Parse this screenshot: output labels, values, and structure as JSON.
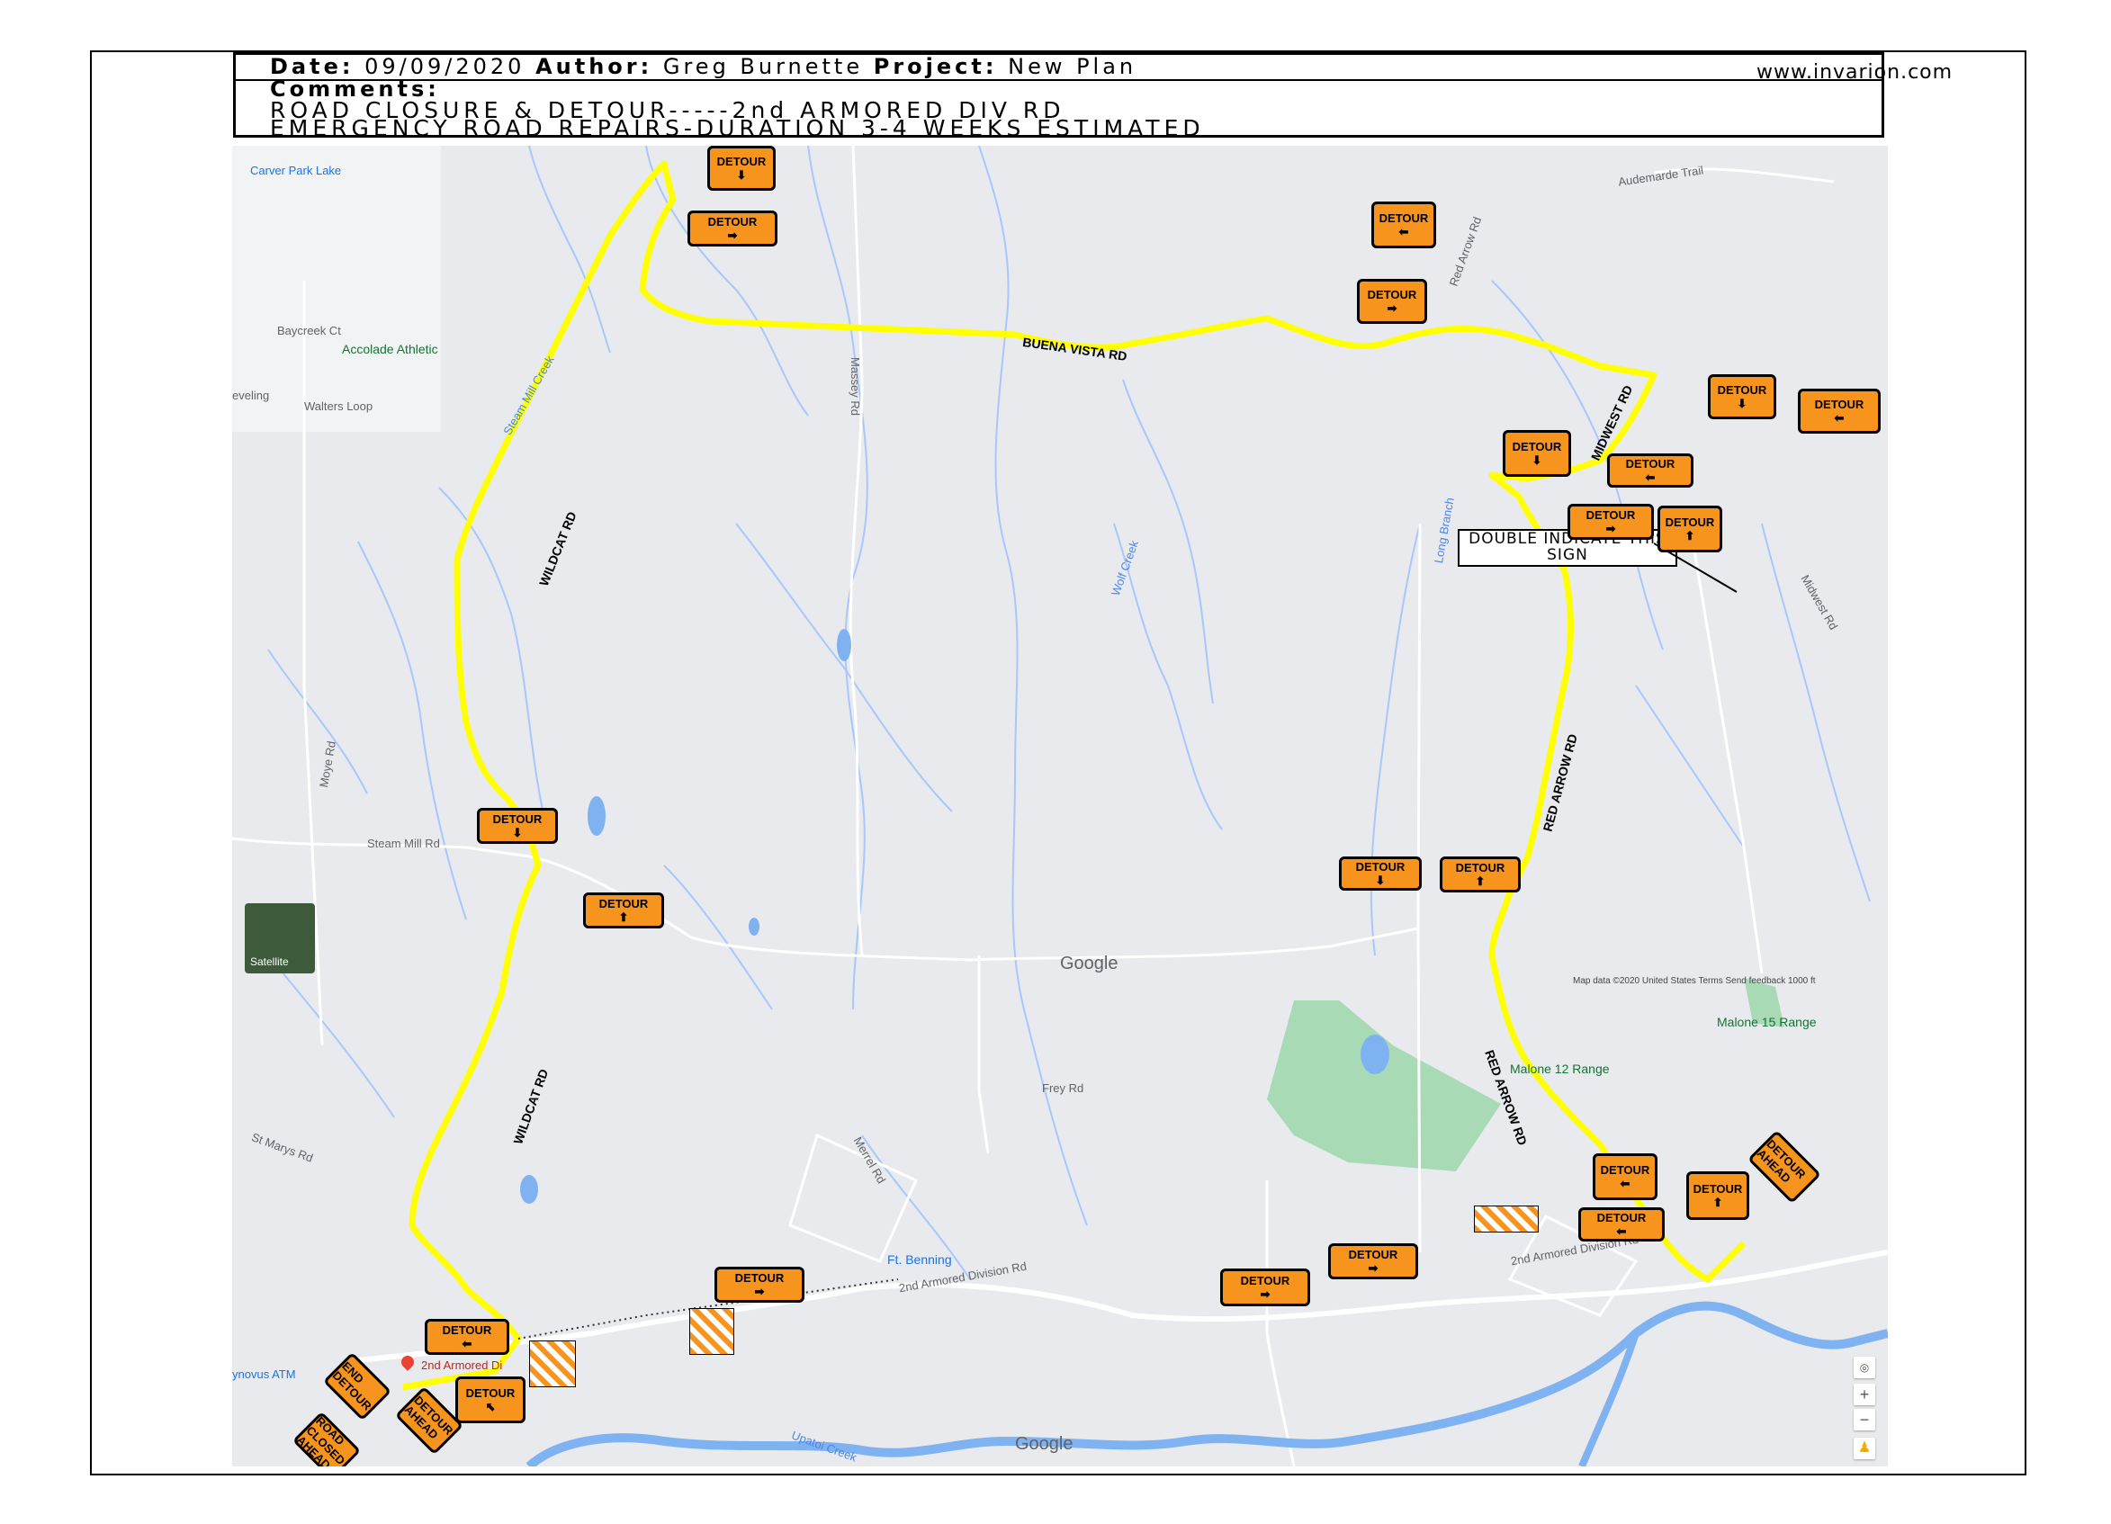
{
  "header": {
    "date_label": "Date:",
    "date": "09/09/2020",
    "author_label": "Author:",
    "author": "Greg Burnette",
    "project_label": "Project:",
    "project": "New Plan",
    "comments_label": "Comments:",
    "comment_line1": "ROAD CLOSURE & DETOUR-----2nd ARMORED DIV RD",
    "comment_line2": "EMERGENCY ROAD REPAIRS-DURATION 3-4 WEEKS ESTIMATED",
    "website": "www.invarion.com"
  },
  "map": {
    "annotation": "DOUBLE INDICATE THIS SIGN",
    "route_color": "#ffff00",
    "sign_color": "#f7941d",
    "water_color": "#7fb2f0",
    "park_color": "#a8dab5",
    "route_labels": {
      "buena_vista": "BUENA VISTA RD",
      "wildcat_upper": "WILDCAT RD",
      "wildcat_lower": "WILDCAT RD",
      "red_arrow_upper": "RED ARROW RD",
      "red_arrow_lower": "RED ARROW RD",
      "midwest": "MIDWEST RD"
    },
    "places": {
      "carver_park_lake": "Carver Park Lake",
      "accolade_athletic": "Accolade Athletic",
      "ft_benning": "Ft. Benning",
      "malone_12": "Malone 12 Range",
      "malone_15": "Malone 15 Range",
      "synovus": "ynovus ATM",
      "armored_pin": "2nd Armored Di",
      "leveling": "eveling"
    },
    "streets": {
      "steam_mill_creek": "Steam Mill Creek",
      "steam_mill_rd": "Steam Mill Rd",
      "wolf_creek": "Wolf Creek",
      "long_branch": "Long Branch",
      "massey_rd": "Massey Rd",
      "armored_division_rd": "2nd Armored Division Rd",
      "upatoi_creek": "Upatoi Creek",
      "midwest_rd": "Midwest Rd",
      "red_arrow_rd": "Red Arrow Rd",
      "moye_rd": "Moye Rd",
      "st_marys_rd": "St Marys Rd",
      "merrel_rd": "Merrel Rd",
      "frey_rd": "Frey Rd",
      "audemarde_trail": "Audemarde Trail",
      "walters_loop": "Walters Loop",
      "baycreek_ct": "Baycreek Ct"
    },
    "google_logo": "Google",
    "map_footer": "Map data ©2020   United States   Terms   Send feedback   1000 ft",
    "satellite": "Satellite",
    "zoom_in": "+",
    "zoom_out": "−"
  },
  "signs": {
    "detour": "DETOUR",
    "detour_ahead": "DETOUR AHEAD",
    "road_closed_ahead": "ROAD CLOSED AHEAD",
    "end_detour": "END DETOUR",
    "road_closed": "ROAD CLOSED"
  }
}
